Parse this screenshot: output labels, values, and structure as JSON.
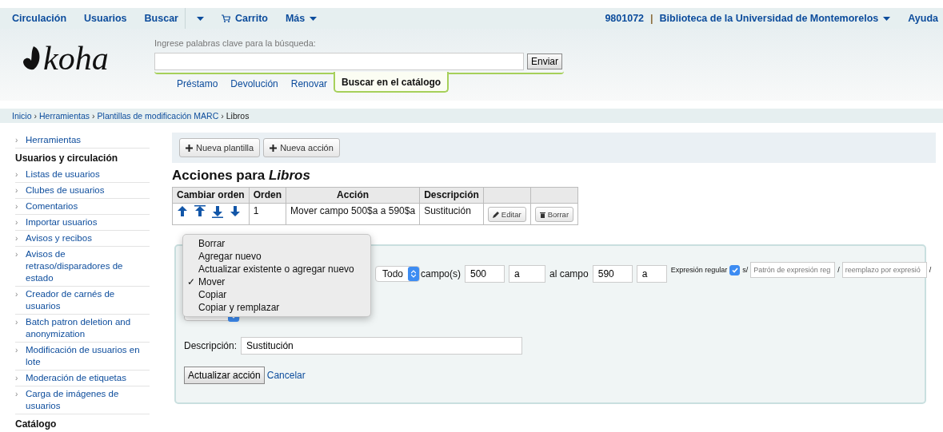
{
  "top_nav": {
    "items": [
      {
        "label": "Circulación",
        "kind": "link"
      },
      {
        "label": "Usuarios",
        "kind": "link"
      },
      {
        "label": "Buscar",
        "kind": "split"
      },
      {
        "label": "Carrito",
        "kind": "cart"
      },
      {
        "label": "Más",
        "kind": "dropdown"
      }
    ],
    "user": "9801072",
    "separator": "|",
    "library": "Biblioteca de la Universidad de Montemorelos",
    "help": "Ayuda"
  },
  "logo": {
    "text": "koha"
  },
  "search": {
    "label": "Ingrese palabras clave para la búsqueda:",
    "button": "Enviar",
    "tabs": [
      {
        "label": "Préstamo",
        "selected": false
      },
      {
        "label": "Devolución",
        "selected": false
      },
      {
        "label": "Renovar",
        "selected": false
      },
      {
        "label": "Buscar en el catálogo",
        "selected": true
      }
    ]
  },
  "breadcrumb": {
    "separator": "›",
    "items": [
      "Inicio",
      "Herramientas",
      "Plantillas de modificación MARC",
      "Libros"
    ]
  },
  "sidebar": {
    "bullet": "›",
    "groups": [
      {
        "items": [
          "Herramientas"
        ]
      },
      {
        "heading": "Usuarios y circulación",
        "items": [
          "Listas de usuarios",
          "Clubes de usuarios",
          "Comentarios",
          "Importar usuarios",
          "Avisos y recibos",
          "Avisos de retraso/disparadores de estado",
          "Creador de carnés de usuarios",
          "Batch patron deletion and anonymization",
          "Modificación de usuarios en lote",
          "Moderación de etiquetas",
          "Carga de imágenes de usuarios"
        ]
      },
      {
        "heading": "Catálogo"
      }
    ]
  },
  "toolbar": {
    "buttons": [
      "Nueva plantilla",
      "Nueva acción"
    ]
  },
  "heading": "Acciones para *Libros*",
  "table": {
    "columns": [
      "Cambiar orden",
      "Orden",
      "Acción",
      "Descripción"
    ],
    "rows": [
      {
        "order": "1",
        "action": "Mover campo 500$a a 590$a",
        "description": "Sustitución",
        "edit": "Editar",
        "delete": "Borrar"
      }
    ]
  },
  "form": {
    "action_menu": [
      {
        "label": "Borrar",
        "selected": false
      },
      {
        "label": "Agregar nuevo",
        "selected": false
      },
      {
        "label": "Actualizar existente o agregar nuevo",
        "selected": false
      },
      {
        "label": "Mover",
        "selected": true
      },
      {
        "label": "Copiar",
        "selected": false
      },
      {
        "label": "Copiar y remplazar",
        "selected": false
      }
    ],
    "check_mark": "✓",
    "field_scope": "Todo",
    "fields_label": "campo(s)",
    "from_field": "500",
    "from_subfield": "a",
    "to_label": "al campo",
    "to_field": "590",
    "to_subfield": "a",
    "regex": {
      "label": "Expresión regular",
      "checked": true,
      "prefix": "s/",
      "pattern_placeholder": "Patrón de expresión reg",
      "separator": "/",
      "replace_placeholder": "reemplazo por expresió",
      "suffix": "/"
    },
    "description_label": "Descripción:",
    "description_value": "Sustitución",
    "submit": "Actualizar acción",
    "cancel": "Cancelar"
  }
}
